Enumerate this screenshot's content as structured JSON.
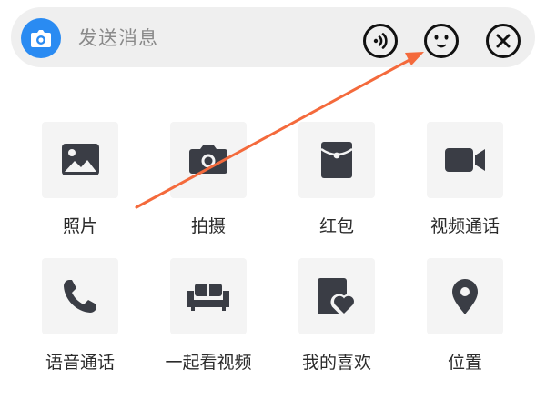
{
  "input_bar": {
    "placeholder": "发送消息",
    "icons": [
      "camera-icon",
      "voice-icon",
      "emoji-icon",
      "close-icon"
    ]
  },
  "panel": {
    "items": [
      {
        "label": "照片",
        "icon": "photo-icon"
      },
      {
        "label": "拍摄",
        "icon": "camera-capture-icon"
      },
      {
        "label": "红包",
        "icon": "red-packet-icon"
      },
      {
        "label": "视频通话",
        "icon": "video-camera-icon"
      },
      {
        "label": "语音通话",
        "icon": "phone-icon"
      },
      {
        "label": "一起看视频",
        "icon": "sofa-icon"
      },
      {
        "label": "我的喜欢",
        "icon": "liked-icon"
      },
      {
        "label": "位置",
        "icon": "location-pin-icon"
      }
    ]
  },
  "colors": {
    "accent": "#2a8bf2",
    "icon": "#3a3d45",
    "annotation_arrow": "#f46a3c"
  }
}
